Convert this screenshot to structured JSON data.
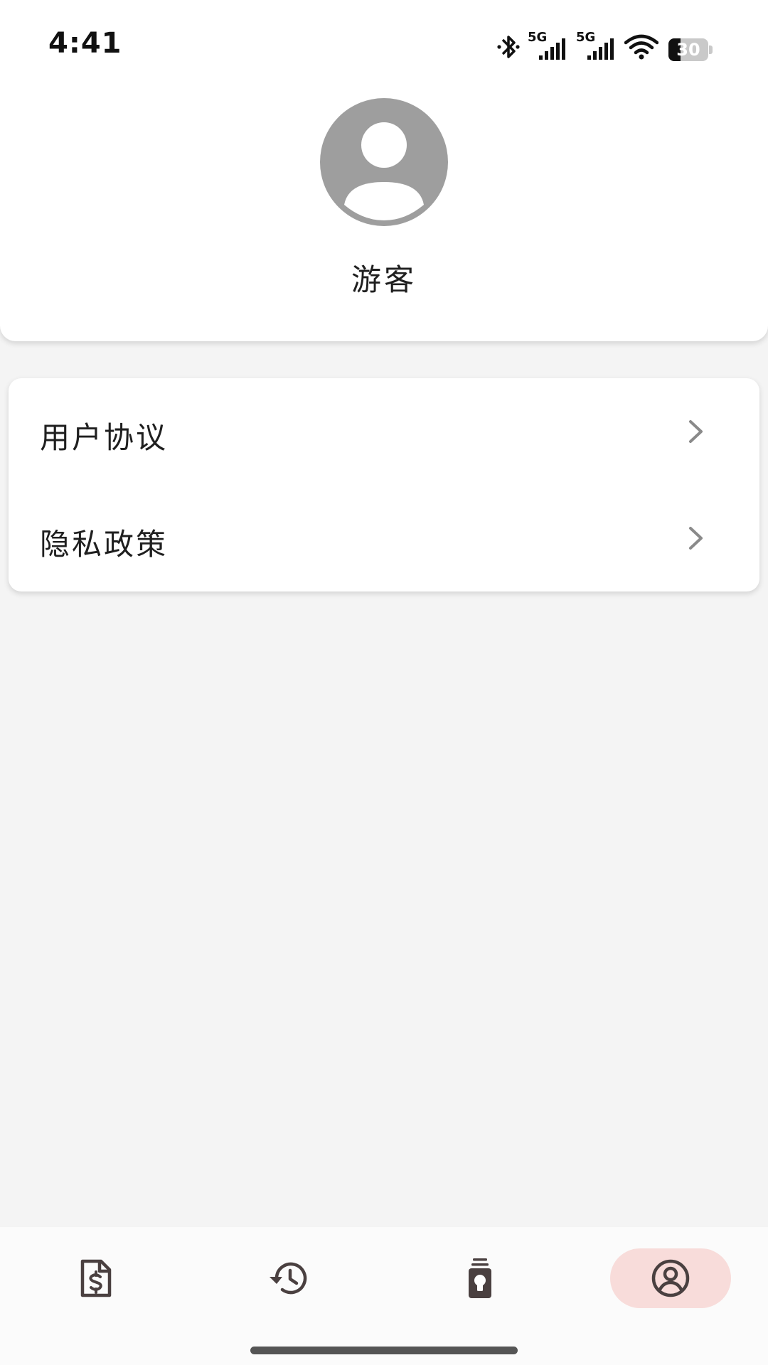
{
  "status_bar": {
    "time": "4:41",
    "network_1": "5G",
    "network_2": "5G",
    "battery": "30",
    "battery_level": 0.3,
    "icons": [
      "bluetooth-icon",
      "signal-5g-icon",
      "signal-5g-icon",
      "wifi-icon",
      "battery-icon"
    ]
  },
  "profile": {
    "avatar_icon": "default-avatar-icon",
    "username": "游客"
  },
  "menu": {
    "items": [
      {
        "label": "用户协议",
        "icon": "chevron-right-icon"
      },
      {
        "label": "隐私政策",
        "icon": "chevron-right-icon"
      }
    ]
  },
  "bottom_nav": {
    "items": [
      {
        "icon": "invoice-dollar-icon",
        "active": false
      },
      {
        "icon": "history-icon",
        "active": false
      },
      {
        "icon": "lightbulb-jar-icon",
        "active": false
      },
      {
        "icon": "account-circle-icon",
        "active": true
      }
    ],
    "active_color": "#f8dcda"
  },
  "colors": {
    "background": "#f4f4f4",
    "card": "#ffffff",
    "text": "#1f1f1f",
    "avatar_gray": "#9e9e9e",
    "icon_dark": "#4a4040"
  }
}
